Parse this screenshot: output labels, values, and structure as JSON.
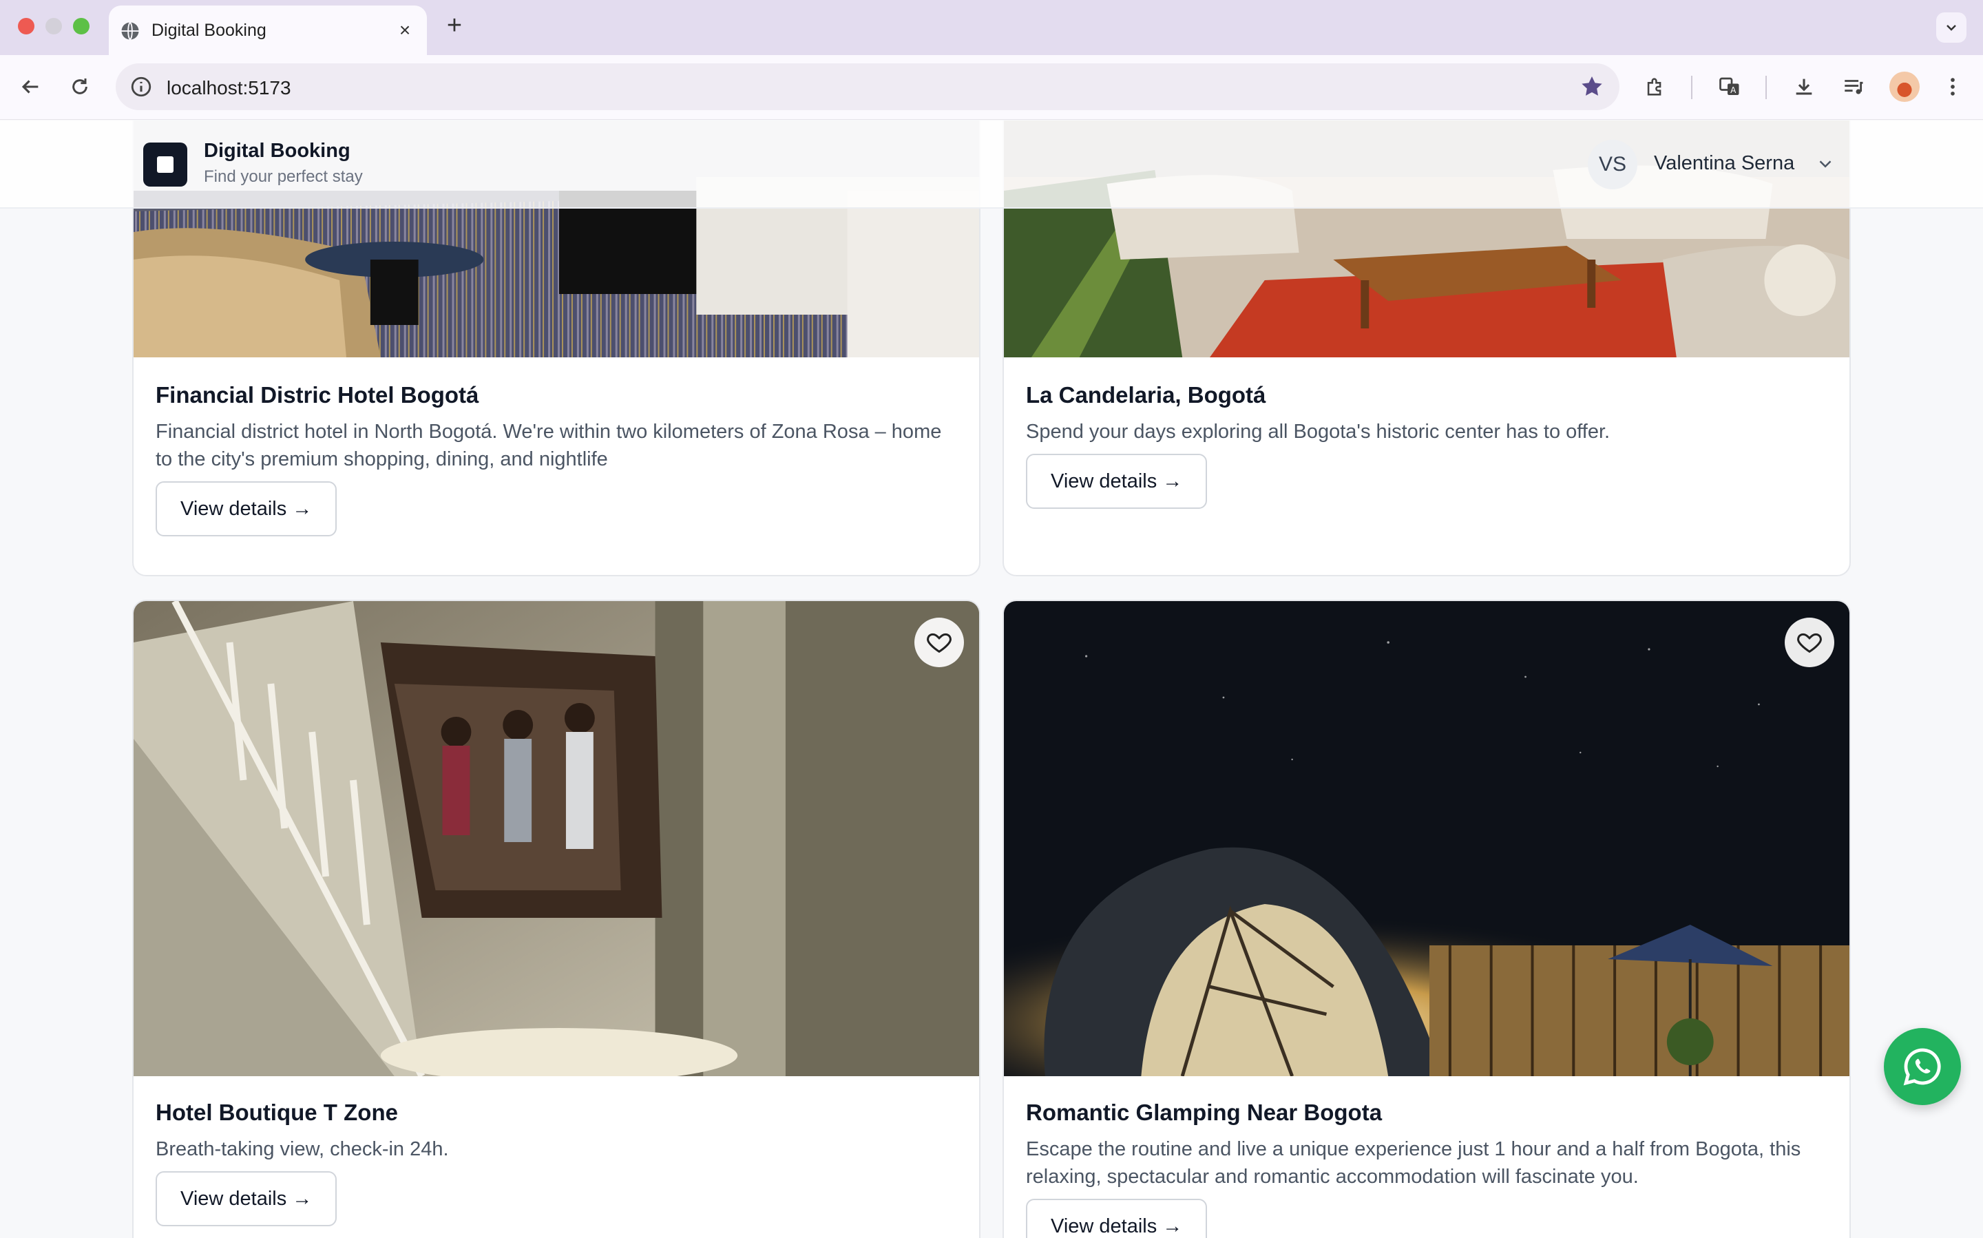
{
  "browser": {
    "tab_title": "Digital Booking",
    "new_tab_symbol": "+",
    "close_symbol": "×",
    "url": "localhost:5173"
  },
  "header": {
    "brand_title": "Digital Booking",
    "brand_subtitle": "Find your perfect stay",
    "user_initials": "VS",
    "user_name": "Valentina Serna"
  },
  "cards": [
    {
      "title": "Financial Distric Hotel Bogotá",
      "description": "Financial district hotel in North Bogotá. We're within two kilometers of Zona Rosa – home to the city's premium shopping, dining, and nightlife",
      "button": "View details →"
    },
    {
      "title": "La Candelaria, Bogotá",
      "description": "Spend your days exploring all Bogota's historic center has to offer.",
      "button": "View details →"
    },
    {
      "title": "Hotel Boutique T Zone",
      "description": "Breath-taking view, check-in 24h.",
      "button": "View details →"
    },
    {
      "title": "Romantic Glamping Near Bogota",
      "description": "Escape the routine and live a unique experience just 1 hour and a half from Bogota, this relaxing, spectacular and romantic accommodation will fascinate you.",
      "button": "View details →"
    }
  ],
  "colors": {
    "tabbar": "#e3dcef",
    "brand_dark": "#111827",
    "whatsapp": "#22b35f",
    "bookmark_star": "#5b4c8a"
  }
}
